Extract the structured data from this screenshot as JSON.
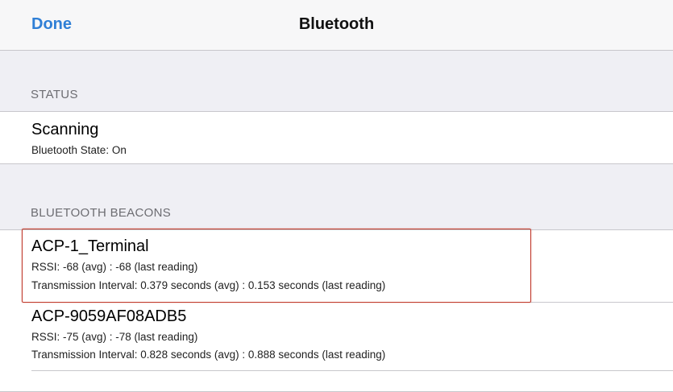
{
  "nav": {
    "done_label": "Done",
    "title": "Bluetooth"
  },
  "status_section": {
    "header": "STATUS",
    "title": "Scanning",
    "subtitle": "Bluetooth State: On"
  },
  "beacons_section": {
    "header": "BLUETOOTH BEACONS",
    "items": [
      {
        "name": "ACP-1_Terminal",
        "rssi": "RSSI: -68 (avg) : -68 (last reading)",
        "interval": "Transmission Interval: 0.379 seconds (avg) : 0.153 seconds (last reading)",
        "highlighted": true
      },
      {
        "name": "ACP-9059AF08ADB5",
        "rssi": "RSSI: -75 (avg) : -78 (last reading)",
        "interval": "Transmission Interval: 0.828 seconds (avg) : 0.888 seconds (last reading)",
        "highlighted": false
      }
    ]
  },
  "colors": {
    "accent": "#2f7fd6",
    "highlight_border": "#c0392b",
    "background": "#efeff4"
  }
}
